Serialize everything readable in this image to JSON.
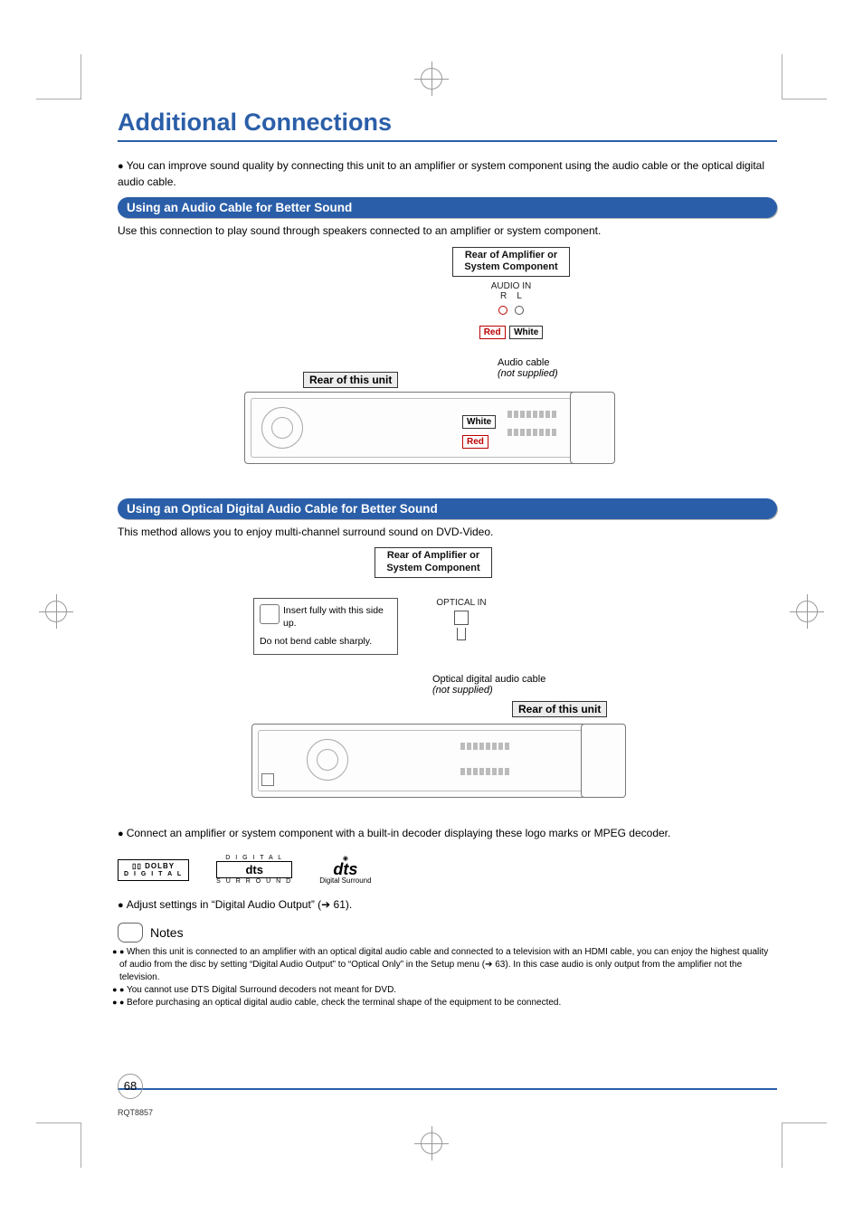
{
  "title": "Additional Connections",
  "intro_bullet": "You can improve sound quality by connecting this unit to an amplifier or system component using the audio cable or the optical digital audio cable.",
  "section1": {
    "heading": "Using an Audio Cable for Better Sound",
    "desc": "Use this connection to play sound through speakers connected to an amplifier or system component.",
    "rear_amp": "Rear of Amplifier or System Component",
    "audio_in": "AUDIO IN",
    "r": "R",
    "l": "L",
    "red": "Red",
    "white": "White",
    "rear_unit": "Rear of this unit",
    "cable_name": "Audio cable",
    "cable_supplied": "(not supplied)"
  },
  "section2": {
    "heading": "Using an Optical Digital Audio Cable for Better Sound",
    "desc": "This method allows you to enjoy multi-channel surround sound on DVD-Video.",
    "rear_amp": "Rear of Amplifier or System Component",
    "optical_in": "OPTICAL IN",
    "insert": "Insert fully with this side up.",
    "bend": "Do not bend cable sharply.",
    "cable_name": "Optical digital audio cable",
    "cable_supplied": "(not supplied)",
    "rear_unit": "Rear of this unit"
  },
  "decoder_bullet": "Connect an amplifier or system component with a built-in decoder displaying these logo marks or MPEG decoder.",
  "logos": {
    "dolby": "DOLBY",
    "dolby_digital": "D I G I T A L",
    "dts_upper": "D I G I T A L",
    "dts": "dts",
    "dts_surround": "S U R R O U N D",
    "dts_label": "Digital Surround"
  },
  "adjust_bullet": "Adjust settings in “Digital Audio Output” (➔ 61).",
  "notes_title": "Notes",
  "notes": [
    "When this unit is connected to an amplifier with an optical digital audio cable and connected to a television with an HDMI cable, you can enjoy the highest quality of audio from the disc by setting “Digital Audio Output” to “Optical Only” in the Setup menu (➔ 63). In this case audio is only output from the amplifier not the television.",
    "You cannot use DTS Digital Surround decoders not meant for DVD.",
    "Before purchasing an optical digital audio cable, check the terminal shape of the equipment to be connected."
  ],
  "page_number": "68",
  "doc_code": "RQT8857"
}
